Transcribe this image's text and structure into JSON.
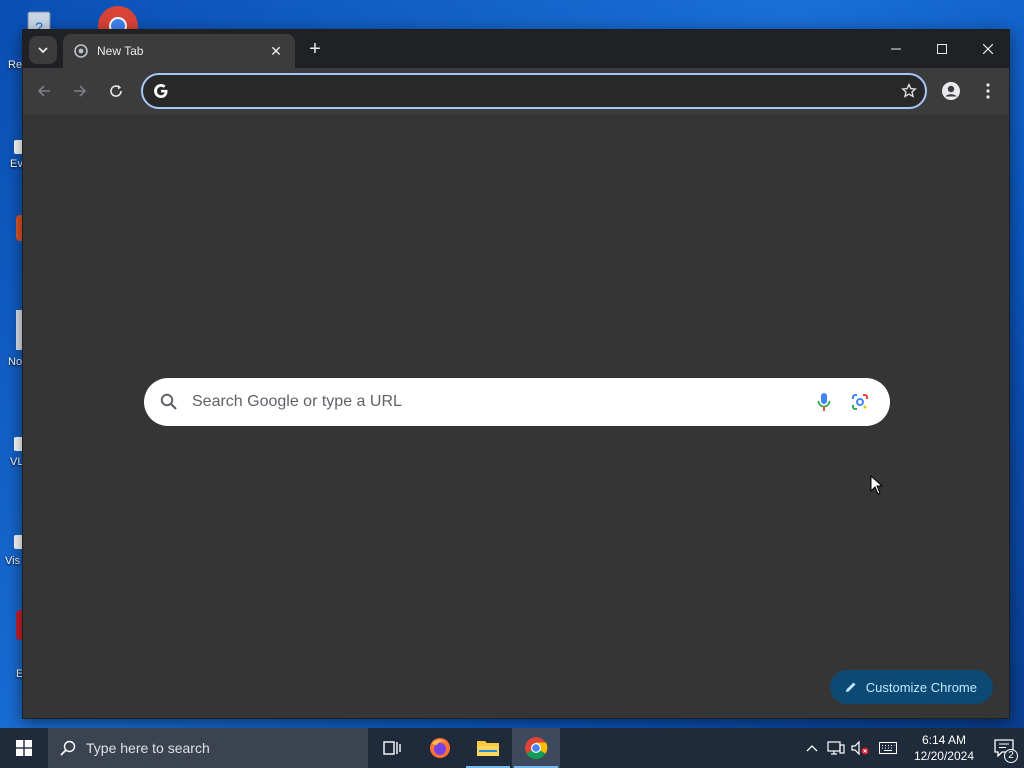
{
  "desktop": {
    "labels": [
      "Re",
      "Ev",
      "No",
      "VL",
      "Vis",
      "E"
    ]
  },
  "browser": {
    "tab": {
      "title": "New Tab"
    },
    "omnibox": {
      "value": "",
      "placeholder": ""
    }
  },
  "ntp": {
    "search_placeholder": "Search Google or type a URL",
    "customize_label": "Customize Chrome"
  },
  "taskbar": {
    "search_placeholder": "Type here to search",
    "time": "6:14 AM",
    "date": "12/20/2024",
    "notification_count": "2"
  },
  "colors": {
    "accent": "#a8c7fa",
    "customize_bg": "#0c4a74",
    "customize_text": "#c2e7ff"
  }
}
